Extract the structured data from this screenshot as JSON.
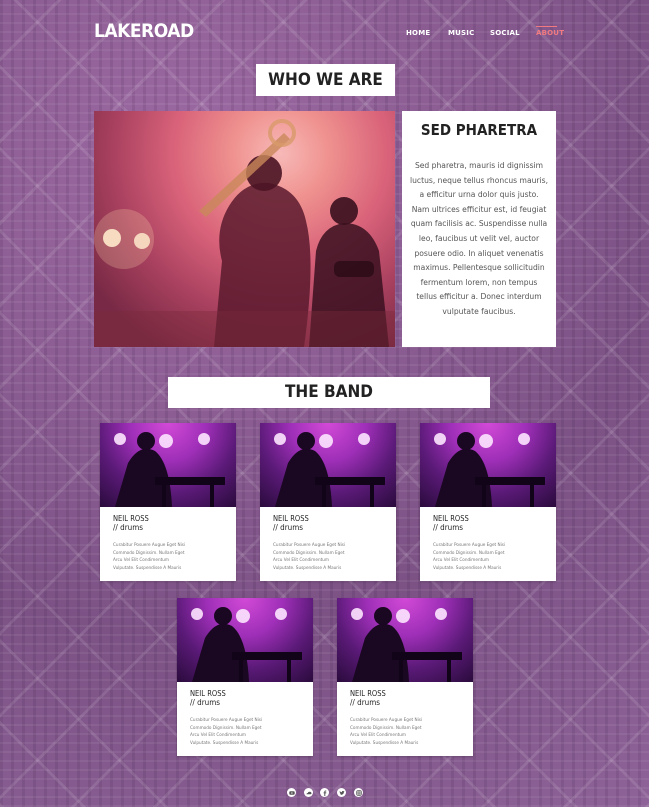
{
  "header": {
    "logo": "LAKEROAD",
    "nav": [
      {
        "label": "HOME"
      },
      {
        "label": "MUSIC"
      },
      {
        "label": "SOCIAL"
      },
      {
        "label": "ABOUT",
        "active": true
      }
    ]
  },
  "who_we_are": {
    "title": "WHO WE ARE",
    "card_title": "SED PHARETRA",
    "card_text": "Sed pharetra, mauris id dignissim luctus, neque tellus rhoncus mauris, a efficitur urna dolor quis justo. Nam ultrices efficitur est, id feugiat quam facilisis ac. Suspendisse nulla leo, faucibus ut velit vel, auctor posuere odio. In aliquet venenatis maximus. Pellentesque sollicitudin fermentum lorem, non tempus tellus efficitur a. Donec interdum vulputate faucibus."
  },
  "band": {
    "title": "THE BAND",
    "members": [
      {
        "name": "NEIL ROSS",
        "role": "// drums",
        "desc": [
          "Curabitur Posuere Augue Eget Nisi",
          "Commodo Dignissim. Nullam Eget",
          "Arcu Vel Elit Condimentum",
          "Vulputate. Suspendisse A Mauris"
        ]
      },
      {
        "name": "NEIL ROSS",
        "role": "// drums",
        "desc": [
          "Curabitur Posuere Augue Eget Nisi",
          "Commodo Dignissim. Nullam Eget",
          "Arcu Vel Elit Condimentum",
          "Vulputate. Suspendisse A Mauris"
        ]
      },
      {
        "name": "NEIL ROSS",
        "role": "// drums",
        "desc": [
          "Curabitur Posuere Augue Eget Nisi",
          "Commodo Dignissim. Nullam Eget",
          "Arcu Vel Elit Condimentum",
          "Vulputate. Suspendisse A Mauris"
        ]
      },
      {
        "name": "NEIL ROSS",
        "role": "// drums",
        "desc": [
          "Curabitur Posuere Augue Eget Nisi",
          "Commodo Dignissim. Nullam Eget",
          "Arcu Vel Elit Condimentum",
          "Vulputate. Suspendisse A Mauris"
        ]
      },
      {
        "name": "NEIL ROSS",
        "role": "// drums",
        "desc": [
          "Curabitur Posuere Augue Eget Nisi",
          "Commodo Dignissim. Nullam Eget",
          "Arcu Vel Elit Condimentum",
          "Vulputate. Suspendisse A Mauris"
        ]
      }
    ]
  },
  "footer": {
    "social_icons": [
      "youtube-icon",
      "soundcloud-icon",
      "facebook-icon",
      "twitter-icon",
      "instagram-icon"
    ]
  },
  "colors": {
    "accent": "#f07a80",
    "background": "#8a5f93",
    "card": "#ffffff"
  }
}
